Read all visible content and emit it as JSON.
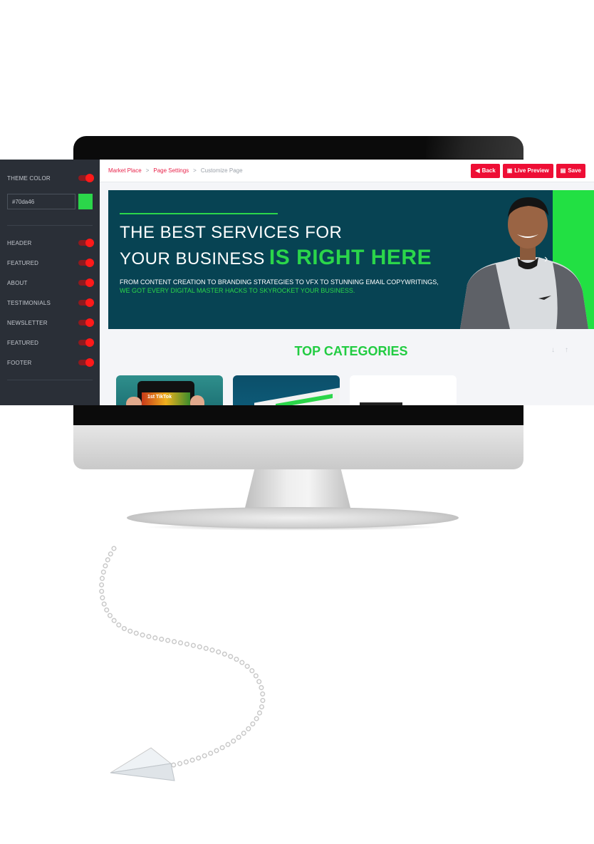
{
  "sidebar": {
    "theme_color_label": "THEME COLOR",
    "color_value": "#70da46",
    "swatch_color": "#2bd64a",
    "items": [
      {
        "label": "HEADER"
      },
      {
        "label": "FEATURED"
      },
      {
        "label": "ABOUT"
      },
      {
        "label": "TESTIMONIALS"
      },
      {
        "label": "NEWSLETTER"
      },
      {
        "label": "FEATURED"
      },
      {
        "label": "FOOTER"
      }
    ]
  },
  "breadcrumb": {
    "items": [
      "Market Place",
      "Page Settings",
      "Customize Page"
    ],
    "separator": ">"
  },
  "toolbar": {
    "back_label": "Back",
    "live_preview_label": "Live Preview",
    "save_label": "Save"
  },
  "hero": {
    "line1": "THE BEST SERVICES FOR",
    "line2": "YOUR BUSINESS",
    "accent": "IS RIGHT HERE",
    "sub1": "FROM CONTENT CREATION TO BRANDING STRATEGIES TO VFX TO STUNNING EMAIL COPYWRITINGS,",
    "sub2": "WE GOT EVERY DIGITAL MASTER HACKS TO SKYROCKET YOUR BUSINESS."
  },
  "categories": {
    "title": "TOP CATEGORIES",
    "card1_text": "1st TikTok"
  },
  "colors": {
    "accent_green": "#2bd64a",
    "brand_red": "#ee0e35",
    "hero_bg": "#074353",
    "sidebar_bg": "#2a2f37"
  },
  "icons": {
    "back": "arrow-circle-left-icon",
    "live_preview": "monitor-icon",
    "save": "floppy-disk-icon",
    "hero_next": "chevron-right-icon",
    "cat_down": "arrow-down-icon",
    "cat_up": "arrow-up-icon",
    "decoration": "paper-plane-icon"
  }
}
